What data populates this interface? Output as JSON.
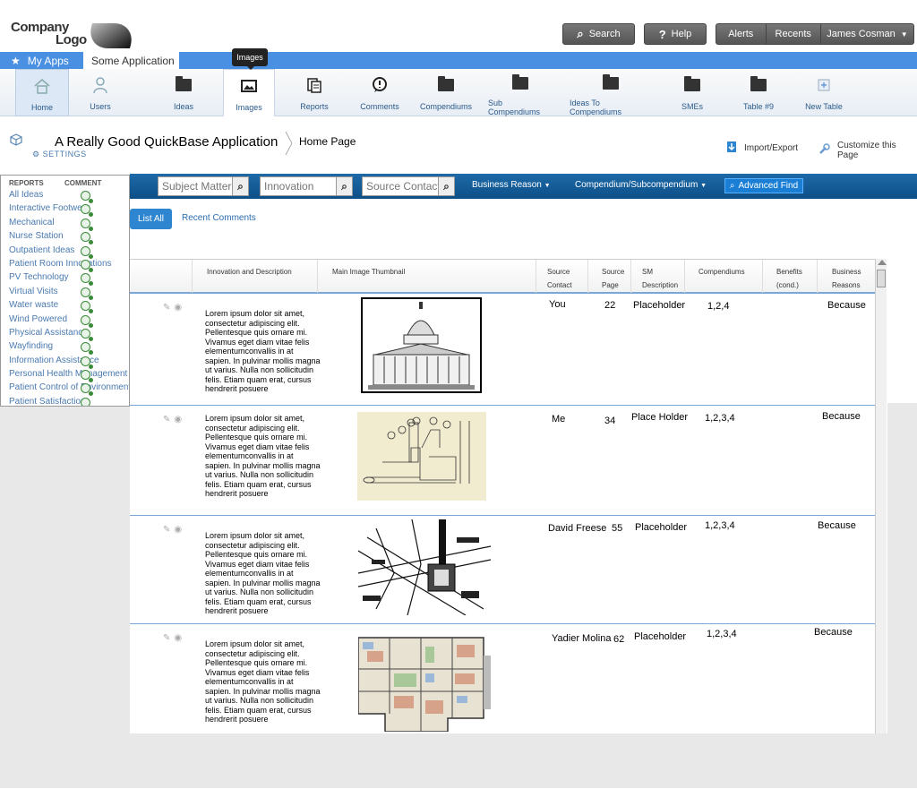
{
  "logo": {
    "line1": "Company",
    "line2": "Logo"
  },
  "top_buttons": {
    "search": "Search",
    "help": "Help"
  },
  "user_bar": {
    "alerts": "Alerts",
    "recents": "Recents",
    "user": "James Cosman"
  },
  "app_bar": {
    "my_apps": "My Apps",
    "current_app": "Some Application"
  },
  "tooltip": "Images",
  "toolbar": [
    {
      "label": "Home"
    },
    {
      "label": "Users"
    },
    {
      "label": "Ideas"
    },
    {
      "label": "Images"
    },
    {
      "label": "Reports"
    },
    {
      "label": "Comments"
    },
    {
      "label": "Compendiums"
    },
    {
      "label": "Sub Compendiums"
    },
    {
      "label": "Ideas To Compendiums"
    },
    {
      "label": "SMEs"
    },
    {
      "label": "Table #9"
    },
    {
      "label": "New Table"
    }
  ],
  "page": {
    "app_title": "A Really Good QuickBase Application",
    "settings": "SETTINGS",
    "breadcrumb": "Home Page",
    "import_export": "Import/Export",
    "customize": "Customize this Page"
  },
  "left_panel": {
    "header_reports": "REPORTS",
    "header_comment": "COMMENT",
    "items": [
      "All Ideas",
      "Interactive Footwear",
      "Mechanical",
      "Nurse Station",
      "Outpatient Ideas",
      "Patient Room Innovations",
      "PV Technology",
      "Virtual Visits",
      "Water waste",
      "Wind Powered",
      "Physical Assistance",
      "Wayfinding",
      "Information Assistance",
      "Personal Health Management",
      "Patient Control of Environment",
      "Patient Satisfaction"
    ]
  },
  "filters": {
    "subject_placeholder": "Subject Matter",
    "innovation_placeholder": "Innovation",
    "source_placeholder": "Source Contact",
    "business_reason": "Business Reason",
    "compendium": "Compendium/Subcompendium",
    "advanced_find": "Advanced Find"
  },
  "tabs": {
    "list_all": "List All",
    "recent_comments": "Recent Comments"
  },
  "table": {
    "headers": {
      "innovation": "Innovation and Description",
      "thumbnail": "Main Image Thumbnail",
      "source_contact_1": "Source",
      "source_contact_2": "Contact",
      "source_page_1": "Source",
      "source_page_2": "Page",
      "sm_desc_1": "SM",
      "sm_desc_2": "Description",
      "compendiums": "Compendiums",
      "benefits_1": "Benefits",
      "benefits_2": "(cond.)",
      "business_1": "Business",
      "business_2": "Reasons"
    },
    "rows": [
      {
        "desc": "Lorem ipsum dolor sit amet, consectetur adipiscing elit. Pellentesque quis ornare mi. Vivamus eget diam vitae felis elementumconvallis in at sapien. In pulvinar mollis magna ut varius. Nulla non sollicitudin felis. Etiam quam erat, cursus hendrerit posuere",
        "contact": "You",
        "page": "22",
        "sm": "Placeholder",
        "compendiums": "1,2,4",
        "reason": "Because"
      },
      {
        "desc": "Lorem ipsum dolor sit amet, consectetur adipiscing elit. Pellentesque quis ornare mi. Vivamus eget diam vitae felis elementumconvallis in at sapien. In pulvinar mollis magna ut varius. Nulla non sollicitudin felis. Etiam quam erat, cursus hendrerit posuere",
        "contact": "Me",
        "page": "34",
        "sm": "Place Holder",
        "compendiums": "1,2,3,4",
        "reason": "Because"
      },
      {
        "desc": "Lorem ipsum dolor sit amet, consectetur adipiscing elit. Pellentesque quis ornare mi. Vivamus eget diam vitae felis elementumconvallis in at sapien. In pulvinar mollis magna ut varius. Nulla non sollicitudin felis. Etiam quam erat, cursus hendrerit posuere",
        "contact": "David Freese",
        "page": "55",
        "sm": "Placeholder",
        "compendiums": "1,2,3,4",
        "reason": "Because"
      },
      {
        "desc": "Lorem ipsum dolor sit amet, consectetur adipiscing elit. Pellentesque quis ornare mi. Vivamus eget diam vitae felis elementumconvallis in at sapien. In pulvinar mollis magna ut varius. Nulla non sollicitudin felis. Etiam quam erat, cursus hendrerit posuere",
        "contact": "Yadier Molina",
        "page": "62",
        "sm": "Placeholder",
        "compendiums": "1,2,3,4",
        "reason": "Because"
      }
    ]
  },
  "colors": {
    "accent": "#4a90e2",
    "filter_bar": "#0d4f87",
    "link": "#4a7ab0"
  }
}
